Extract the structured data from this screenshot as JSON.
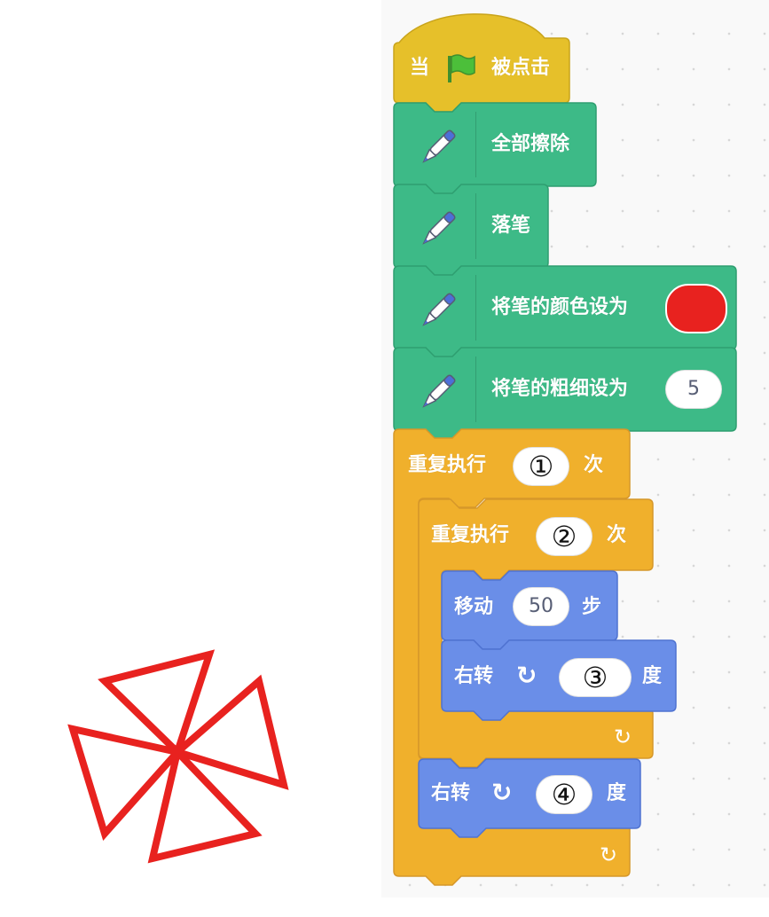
{
  "stage": {
    "pen_color": "#e8221f",
    "icon": "pinwheel-drawing"
  },
  "script": {
    "hat": {
      "label_before": "当",
      "flag_icon": "green-flag",
      "label_after": "被点击",
      "color": "#e6c02a"
    },
    "pen_blocks": [
      {
        "label": "全部擦除",
        "icon": "pen-icon"
      },
      {
        "label": "落笔",
        "icon": "pen-icon"
      },
      {
        "label": "将笔的颜色设为",
        "icon": "pen-icon",
        "color_value": "#e8221f"
      },
      {
        "label": "将笔的粗细设为",
        "icon": "pen-icon",
        "value": "5"
      }
    ],
    "outer_repeat": {
      "label": "重复执行",
      "count": "①",
      "suffix": "次",
      "color": "#f0b02c"
    },
    "inner_repeat": {
      "label": "重复执行",
      "count": "②",
      "suffix": "次"
    },
    "move": {
      "label": "移动",
      "steps": "50",
      "suffix": "步",
      "color": "#6a8ee8"
    },
    "inner_turn": {
      "label": "右转",
      "icon": "rotate-clockwise-icon",
      "degrees": "③",
      "suffix": "度"
    },
    "outer_turn": {
      "label": "右转",
      "icon": "rotate-clockwise-icon",
      "degrees": "④",
      "suffix": "度"
    },
    "loop_arrow": "↻"
  }
}
